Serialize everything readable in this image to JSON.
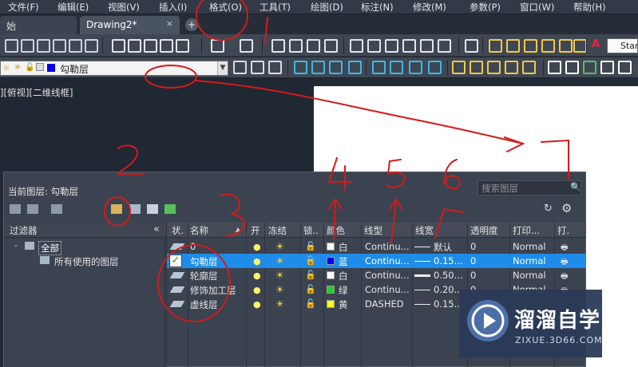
{
  "menu": {
    "items": [
      "文件(F)",
      "编辑(E)",
      "视图(V)",
      "插入(I)",
      "格式(O)",
      "工具(T)",
      "绘图(D)",
      "标注(N)",
      "修改(M)",
      "参数(P)",
      "窗口(W)",
      "帮助(H)"
    ]
  },
  "tabs": {
    "start": "始",
    "drawing": "Drawing2*",
    "close": "×",
    "add": "+"
  },
  "toolbar": {
    "text_style": "Star"
  },
  "layer_toolbar": {
    "current_layer": "勾勒层"
  },
  "viewport": {
    "label": "][俯视][二维线框]"
  },
  "layer_panel": {
    "current_label": "当前图层: 勾勒层",
    "search_placeholder": "搜索图层",
    "filter_title": "过滤器",
    "filter_all": "全部",
    "filter_used": "所有使用的图层",
    "columns": [
      "状.",
      "名称",
      "开",
      "冻结",
      "锁..",
      "颜色",
      "线型",
      "线宽",
      "透明度",
      "打印...",
      "打."
    ],
    "rows": [
      {
        "name": "0",
        "color_name": "白",
        "color": "#ffffff",
        "linetype": "Continu...",
        "lineweight": "默认",
        "transparency": "0",
        "plot_style": "Normal",
        "selected": false
      },
      {
        "name": "勾勒层",
        "color_name": "蓝",
        "color": "#0000e0",
        "linetype": "Continu...",
        "lineweight": "0.15...",
        "transparency": "0",
        "plot_style": "Normal",
        "selected": true
      },
      {
        "name": "轮廓层",
        "color_name": "白",
        "color": "#ffffff",
        "linetype": "Continu...",
        "lineweight": "0.50...",
        "transparency": "0",
        "plot_style": "Normal",
        "selected": false
      },
      {
        "name": "修饰加工层",
        "color_name": "绿",
        "color": "#23d21f",
        "linetype": "Continu...",
        "lineweight": "0.20...",
        "transparency": "0",
        "plot_style": "Normal",
        "selected": false
      },
      {
        "name": "虚线层",
        "color_name": "黄",
        "color": "#ffff00",
        "linetype": "DASHED",
        "lineweight": "0.15...",
        "transparency": "",
        "plot_style": "",
        "selected": false
      }
    ]
  },
  "watermark": {
    "title": "溜溜自学",
    "url": "ZIXUE.3D66.COM"
  },
  "annotations": [
    "1",
    "2",
    "3",
    "4",
    "5",
    "6",
    "7"
  ],
  "colors": {
    "accent_selection": "#1e8ce8",
    "annotation_red": "#d41a1a",
    "canvas_dark": "#202833"
  }
}
